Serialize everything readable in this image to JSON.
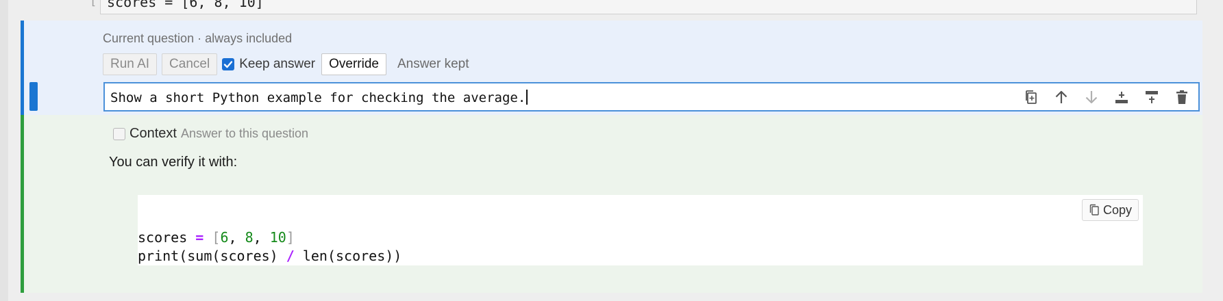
{
  "previous_cell": {
    "prompt": "[ ]:",
    "code": "scores = [6, 8, 10]"
  },
  "prompt_cell": {
    "caption": "Current question · always included",
    "toolbar": {
      "run_label": "Run AI",
      "cancel_label": "Cancel",
      "keep_answer_label": "Keep answer",
      "keep_answer_checked": true,
      "override_label": "Override",
      "status": "Answer kept"
    },
    "question_text": "Show a short Python example for checking the average.",
    "cell_tools": [
      {
        "name": "duplicate-icon"
      },
      {
        "name": "move-up-icon"
      },
      {
        "name": "move-down-icon"
      },
      {
        "name": "insert-below-icon"
      },
      {
        "name": "insert-above-icon"
      },
      {
        "name": "trash-icon"
      }
    ]
  },
  "response_cell": {
    "context_label": "Context",
    "context_checked": false,
    "context_subtitle": "Answer to this question",
    "intro": "You can verify it with:",
    "copy_label": "Copy",
    "code_lines": [
      [
        {
          "t": "scores ",
          "c": "plain"
        },
        {
          "t": "=",
          "c": "op"
        },
        {
          "t": " ",
          "c": "plain"
        },
        {
          "t": "[",
          "c": "brk"
        },
        {
          "t": "6",
          "c": "num"
        },
        {
          "t": ", ",
          "c": "plain"
        },
        {
          "t": "8",
          "c": "num"
        },
        {
          "t": ", ",
          "c": "plain"
        },
        {
          "t": "10",
          "c": "num"
        },
        {
          "t": "]",
          "c": "brk"
        }
      ],
      [
        {
          "t": "print(sum(scores) ",
          "c": "plain"
        },
        {
          "t": "/",
          "c": "op"
        },
        {
          "t": " len(scores))",
          "c": "plain"
        }
      ]
    ]
  },
  "colors": {
    "prompt_accent": "#1a76d2",
    "response_accent": "#2e9e3e",
    "prompt_bg": "#e9f0fb",
    "response_bg": "#edf4ec",
    "operator": "#aa22ff",
    "number": "#158a1a"
  }
}
